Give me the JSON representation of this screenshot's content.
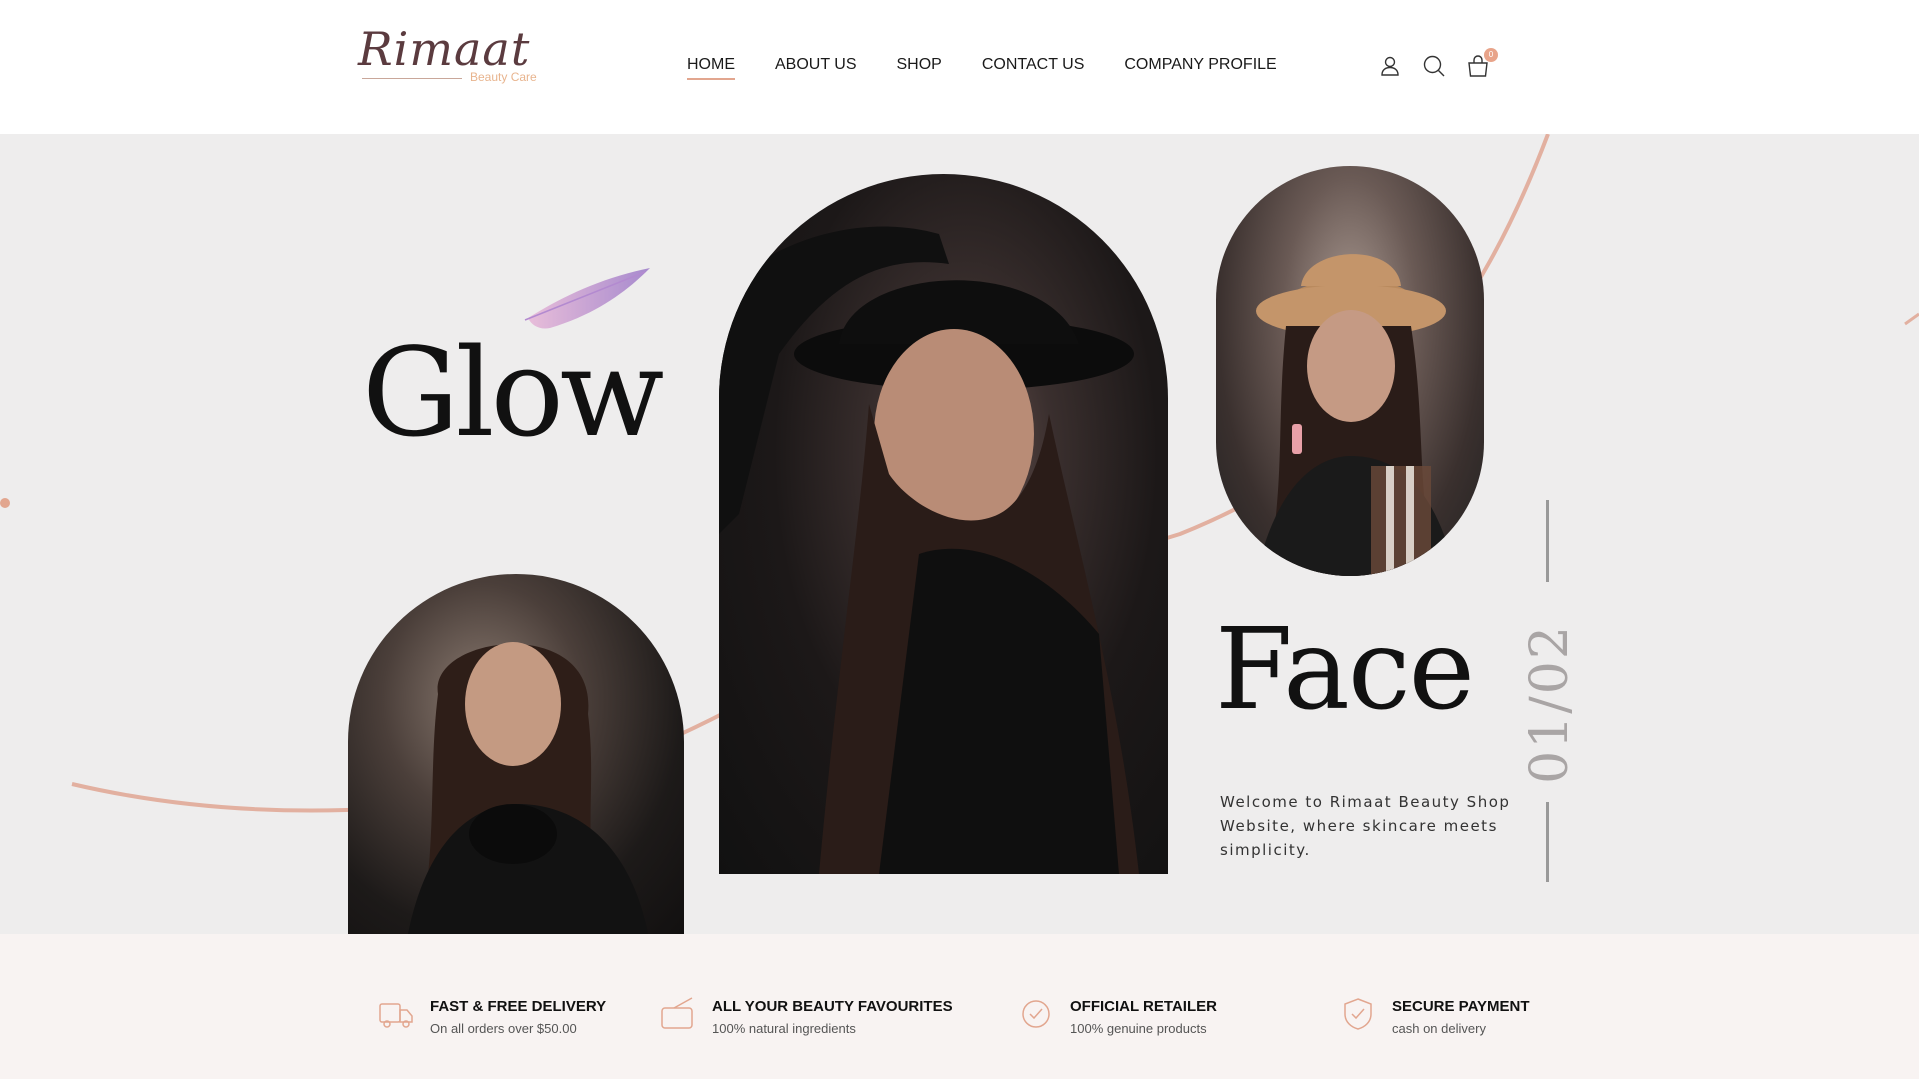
{
  "brand": {
    "logo_text": "Rimaat",
    "logo_subtext": "Beauty Care",
    "accent_color": "#e2a68f"
  },
  "nav": {
    "items": [
      {
        "label": "HOME",
        "active": true
      },
      {
        "label": "ABOUT US",
        "active": false
      },
      {
        "label": "SHOP",
        "active": false
      },
      {
        "label": "CONTACT US",
        "active": false
      },
      {
        "label": "COMPANY PROFILE",
        "active": false
      }
    ]
  },
  "header_icons": {
    "account": "user-icon",
    "search": "search-icon",
    "cart": "shopping-bag-icon",
    "cart_count": "0"
  },
  "hero": {
    "word_left": "Glow",
    "word_right": "Face",
    "welcome_text": "Welcome to Rimaat Beauty Shop Website, where skincare meets simplicity.",
    "slide_counter": "01/02"
  },
  "features": [
    {
      "icon": "delivery-truck-icon",
      "title": "FAST & FREE DELIVERY",
      "subtitle": "On all orders over $50.00"
    },
    {
      "icon": "cosmetic-jar-icon",
      "title": "ALL YOUR BEAUTY FAVOURITES",
      "subtitle": "100% natural ingredients"
    },
    {
      "icon": "check-circle-icon",
      "title": "OFFICIAL RETAILER",
      "subtitle": "100% genuine products"
    },
    {
      "icon": "shield-check-icon",
      "title": "SECURE PAYMENT",
      "subtitle": "cash on delivery"
    }
  ]
}
